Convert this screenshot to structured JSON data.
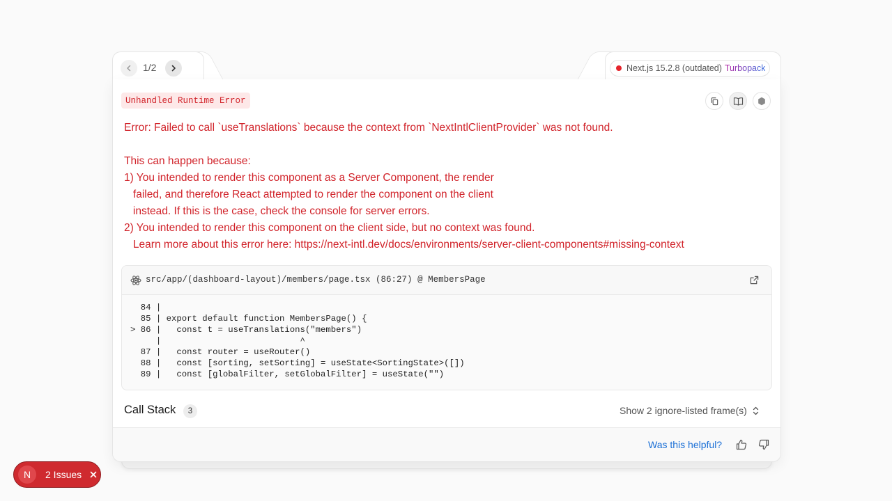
{
  "nav": {
    "page_indicator": "1/2"
  },
  "version": {
    "label": "Next.js 15.2.8 (outdated)",
    "bundler": "Turbopack",
    "status_color": "#e5242c"
  },
  "error": {
    "label": "Unhandled Runtime Error",
    "message": "Error: Failed to call `useTranslations` because the context from `NextIntlClientProvider` was not found.\n\nThis can happen because:\n1) You intended to render this component as a Server Component, the render\n   failed, and therefore React attempted to render the component on the client\n   instead. If this is the case, check the console for server errors.\n2) You intended to render this component on the client side, but no context was found.\n   Learn more about this error here: https://next-intl.dev/docs/environments/server-client-components#missing-context"
  },
  "codeframe": {
    "file": "src/app/(dashboard-layout)/members/page.tsx (86:27) @ MembersPage",
    "code": "  84 |\n  85 | export default function MembersPage() {\n> 86 |   const t = useTranslations(\"members\")\n     |                           ^\n  87 |   const router = useRouter()\n  88 |   const [sorting, setSorting] = useState<SortingState>([])\n  89 |   const [globalFilter, setGlobalFilter] = useState(\"\")"
  },
  "call_stack": {
    "title": "Call Stack",
    "count": "3",
    "toggle_label": "Show 2 ignore-listed frame(s)"
  },
  "footer": {
    "helpful_label": "Was this helpful?"
  },
  "issues": {
    "logo": "N",
    "label": "2 Issues"
  },
  "colors": {
    "error_red": "#d1232a",
    "link_blue": "#1a6fd6"
  }
}
